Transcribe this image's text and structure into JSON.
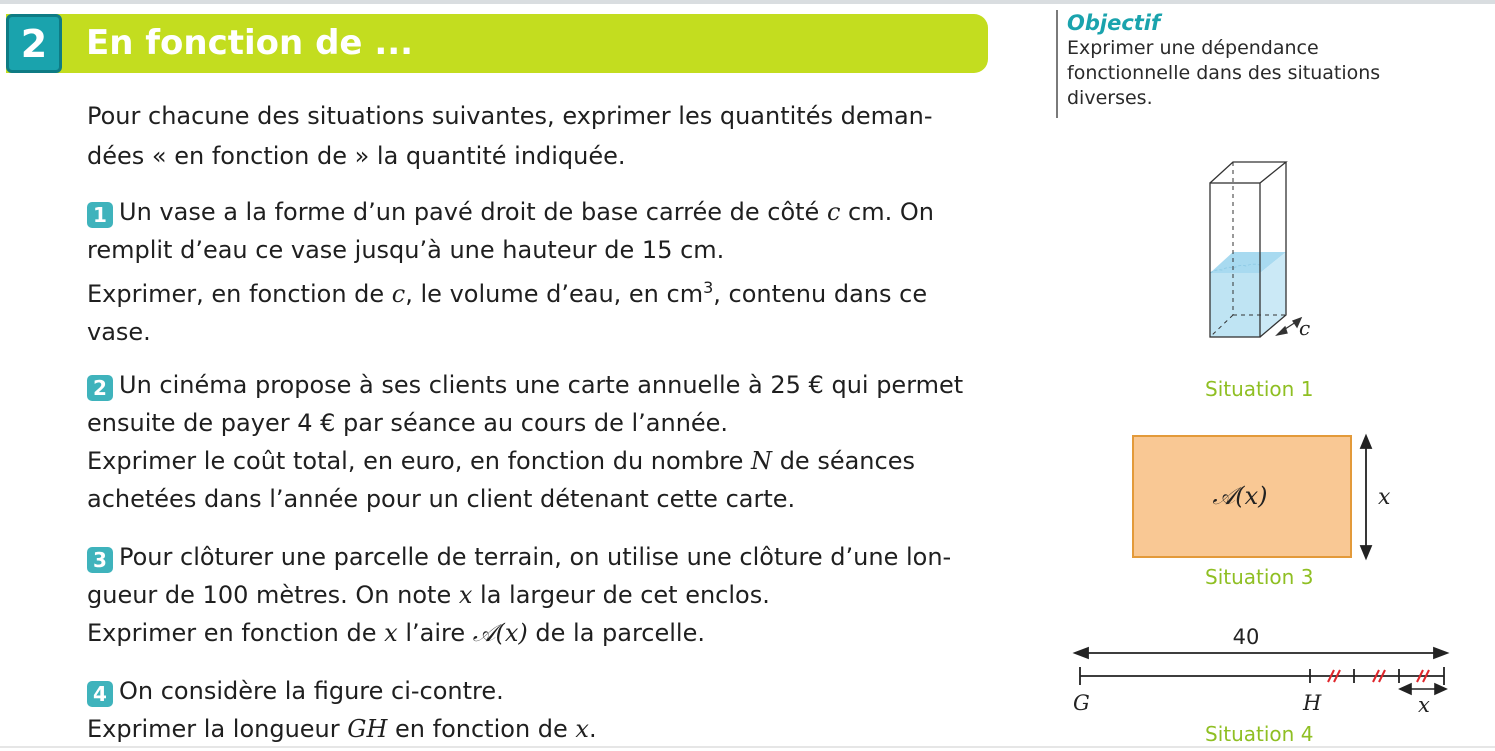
{
  "header": {
    "badge": "2",
    "title": "En fonction de ..."
  },
  "objectif": {
    "heading": "Objectif",
    "line1": "Exprimer une dépendance",
    "line2": "fonctionnelle dans des situations",
    "line3": "diverses."
  },
  "intro": {
    "line1": "Pour chacune des situations suivantes, exprimer les quantités deman-",
    "line2": "dées « en fonction de » la quantité indiquée."
  },
  "q1": {
    "num": "1",
    "a": "Un vase a la forme d’un pavé droit de base carrée de côté",
    "var": "c",
    "b": " cm. On",
    "c": "remplit d’eau ce vase jusqu’à une hauteur de 15 cm.",
    "d": "Exprimer, en fonction de",
    "var2": "c",
    "e": ", le volume d’eau, en cm",
    "sup": "3",
    "f": ", contenu dans ce",
    "g": "vase."
  },
  "q2": {
    "num": "2",
    "a": "Un cinéma propose à ses clients une carte annuelle à 25 € qui permet",
    "b": "ensuite de payer 4 € par séance au cours de l’année.",
    "c": "Exprimer le coût total, en euro, en fonction du nombre",
    "var": "N",
    "d": "de séances",
    "e": "achetées dans l’année pour un client détenant cette carte."
  },
  "q3": {
    "num": "3",
    "a": "Pour clôturer une parcelle de terrain, on utilise une clôture d’une lon-",
    "b": "gueur de 100 mètres. On note",
    "var": "x",
    "c": "la largeur de cet enclos.",
    "d": "Exprimer en fonction de",
    "var2": "x",
    "e": "l’aire",
    "area": "𝒜(x)",
    "f": "de la parcelle."
  },
  "q4": {
    "num": "4",
    "a": "On considère la figure ci-contre.",
    "b": "Exprimer la longueur",
    "var": "GH",
    "c": "en fonction de",
    "var2": "x",
    "d": "."
  },
  "figures": {
    "s1": {
      "caption": "Situation 1",
      "label": "c"
    },
    "s3": {
      "caption": "Situation 3",
      "area_label": "𝒜(x)",
      "side_label": "x"
    },
    "s4": {
      "caption": "Situation 4",
      "length": "40",
      "g": "G",
      "h": "H",
      "x": "x"
    }
  },
  "colors": {
    "banner": "#c3dd1f",
    "badge": "#1aa3ad",
    "accent_caption": "#8fbf23",
    "water": "#bfe4f3",
    "rectangle_fill": "#f9c894",
    "rectangle_border": "#e39a3a",
    "tick_red": "#e0262b"
  }
}
